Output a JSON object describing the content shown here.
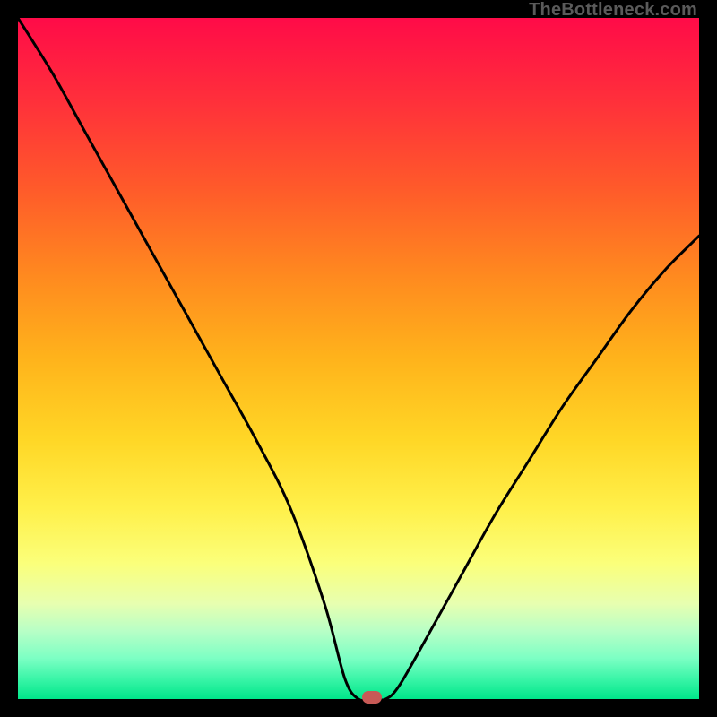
{
  "attribution": "TheBottleneck.com",
  "chart_data": {
    "type": "line",
    "title": "",
    "xlabel": "",
    "ylabel": "",
    "xlim": [
      0,
      100
    ],
    "ylim": [
      0,
      100
    ],
    "series": [
      {
        "name": "bottleneck-curve",
        "x": [
          0,
          5,
          10,
          15,
          20,
          25,
          30,
          35,
          40,
          45,
          48,
          50,
          52,
          54,
          56,
          60,
          65,
          70,
          75,
          80,
          85,
          90,
          95,
          100
        ],
        "y": [
          100,
          92,
          83,
          74,
          65,
          56,
          47,
          38,
          28,
          14,
          3,
          0,
          0,
          0,
          2,
          9,
          18,
          27,
          35,
          43,
          50,
          57,
          63,
          68
        ]
      }
    ],
    "marker": {
      "x": 52,
      "y": 0,
      "name": "optimal-point"
    },
    "background": "heatmap-red-to-green-vertical"
  },
  "colors": {
    "curve": "#000000",
    "marker": "#c85a56",
    "frame": "#000000"
  }
}
